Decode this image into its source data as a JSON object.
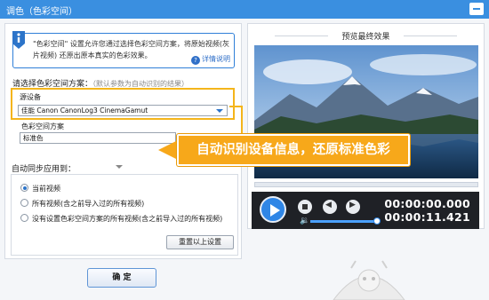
{
  "window": {
    "title": "调色（色彩空间）"
  },
  "info": {
    "text": "\"色彩空间\" 设置允许您通过选择色彩空间方案，将原始视频(灰片视频) 还原出原本真实的色彩效果。",
    "detail_link": "详情说明"
  },
  "choose_scheme": {
    "label": "请选择色彩空间方案：",
    "hint": "（默认参数为自动识别的结果）"
  },
  "source_device": {
    "label": "源设备",
    "value": "佳能  Canon CanonLog3 CinemaGamut"
  },
  "color_space_scheme": {
    "label": "色彩空间方案",
    "value": "标准色"
  },
  "sync": {
    "label": "自动同步应用到：",
    "options": [
      {
        "label": "当前视频",
        "checked": true
      },
      {
        "label": "所有视频(含之前导入过的所有视频)",
        "checked": false
      },
      {
        "label": "没有设置色彩空间方案的所有视频(含之前导入过的所有视频)",
        "checked": false
      }
    ],
    "reset_button": "重置以上设置"
  },
  "confirm_button": "确 定",
  "preview": {
    "title": "预览最终效果",
    "time_current": "00:00:00.000",
    "time_total": "00:00:11.421",
    "volume_level": 0.9
  },
  "callout": {
    "text": "自动识别设备信息，还原标准色彩"
  },
  "colors": {
    "accent": "#3a8fe0",
    "highlight": "#f7a81a",
    "play": "#2f86e6"
  },
  "icons": [
    "info-icon",
    "question-icon",
    "dropdown-arrow-icon",
    "play-icon",
    "stop-icon",
    "previous-icon",
    "next-icon",
    "volume-icon",
    "minimize-icon"
  ]
}
